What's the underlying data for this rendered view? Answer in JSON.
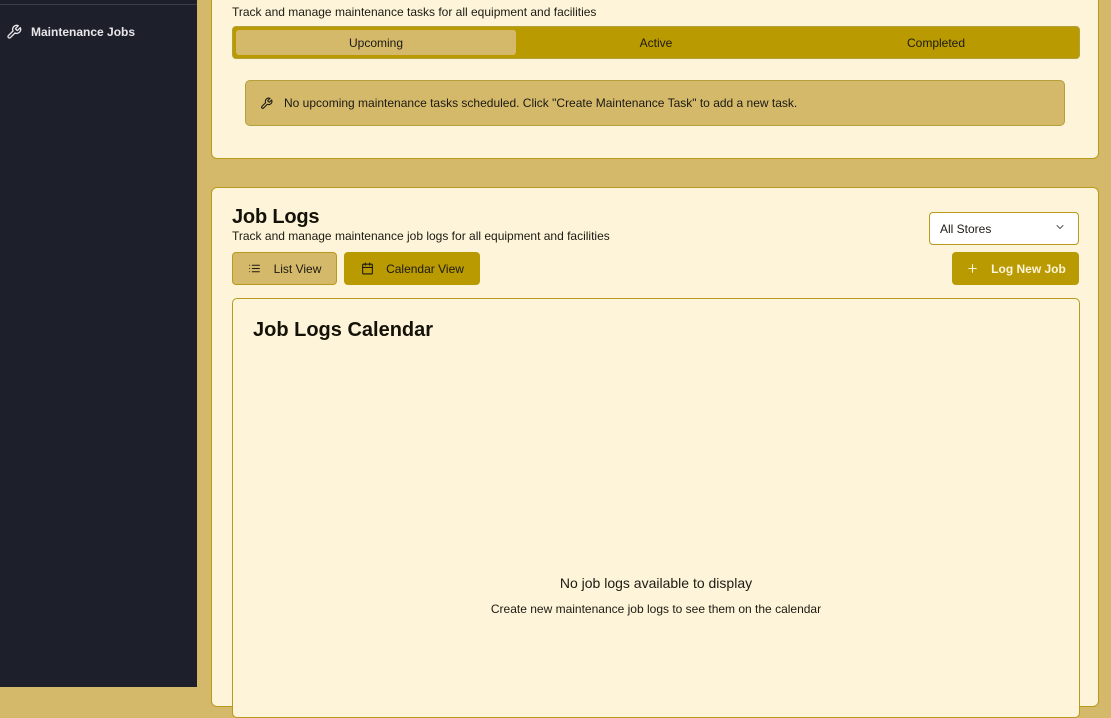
{
  "sidebar": {
    "items": [
      {
        "label": "Maintenance Jobs",
        "icon": "wrench-icon"
      }
    ]
  },
  "maintenance": {
    "subtitle": "Track and manage maintenance tasks for all equipment and facilities",
    "tabs": [
      {
        "label": "Upcoming",
        "active": true
      },
      {
        "label": "Active",
        "active": false
      },
      {
        "label": "Completed",
        "active": false
      }
    ],
    "empty_message": "No upcoming maintenance tasks scheduled. Click \"Create Maintenance Task\" to add a new task."
  },
  "job_logs": {
    "title": "Job Logs",
    "subtitle": "Track and manage maintenance job logs for all equipment and facilities",
    "store_filter": {
      "selected": "All Stores"
    },
    "list_view_label": "List View",
    "calendar_view_label": "Calendar View",
    "log_new_job_label": "Log New Job",
    "calendar": {
      "title": "Job Logs Calendar",
      "empty_title": "No job logs available to display",
      "empty_subtitle": "Create new maintenance job logs to see them on the calendar"
    }
  },
  "colors": {
    "sidebar_bg": "#1d1f2b",
    "page_bg": "#d4b96b",
    "card_bg": "#fdf4d9",
    "accent": "#b99a00"
  }
}
